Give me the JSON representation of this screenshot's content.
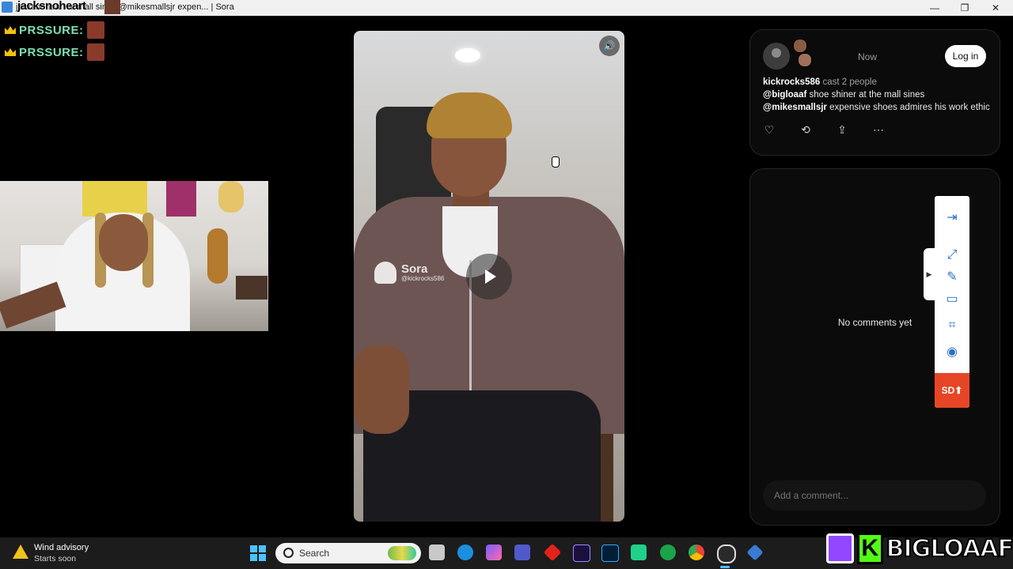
{
  "window": {
    "title": "jacksnoheart at mall sines @mikesmallsjr expen... | Sora",
    "overlay_name": "jacksnoheart",
    "controls": {
      "minimize": "—",
      "maximize": "❐",
      "close": "✕"
    }
  },
  "overlay": {
    "pressure_rows": [
      {
        "label": "PRSSURE:"
      },
      {
        "label": "PRSSURE:"
      }
    ]
  },
  "video": {
    "watermark_name": "Sora",
    "watermark_handle": "@kickrocks586",
    "icons": {
      "mute": "speaker-icon",
      "play": "play-icon"
    }
  },
  "post": {
    "author": "kickrocks586",
    "cast_text": "cast 2 people",
    "time": "Now",
    "login_label": "Log in",
    "lines": [
      {
        "handle": "@bigloaaf",
        "text": " shoe shiner at the mall sines"
      },
      {
        "handle": "@mikesmallsjr",
        "text": " expensive shoes admires his work ethic"
      }
    ],
    "actions": {
      "like": "♡",
      "remix": "⟲",
      "share": "⇪",
      "more": "⋯"
    }
  },
  "comments": {
    "empty_text": "No comments yet",
    "input_placeholder": "Add a comment..."
  },
  "tool_panel": {
    "tools": [
      "exit-icon",
      "expand-icon",
      "pen-icon",
      "window-icon",
      "crop-icon",
      "record-icon"
    ],
    "glyphs": {
      "exit": "⇥",
      "expand": "⤢",
      "pen": "✎",
      "window": "▭",
      "crop": "⌗",
      "record": "◉"
    },
    "sd_label": "SD⬆",
    "tab_glyph": "▶"
  },
  "taskbar": {
    "weather_title": "Wind advisory",
    "weather_sub": "Starts soon",
    "search_label": "Search"
  },
  "brand": {
    "kick_letter": "K",
    "name": "BIGLOAAF"
  },
  "colors": {
    "accent_teal": "#7ee0b0",
    "sd_red": "#e64626",
    "twitch_purple": "#9146ff",
    "kick_green": "#53fc18",
    "windows_blue": "#4cc2ff"
  }
}
